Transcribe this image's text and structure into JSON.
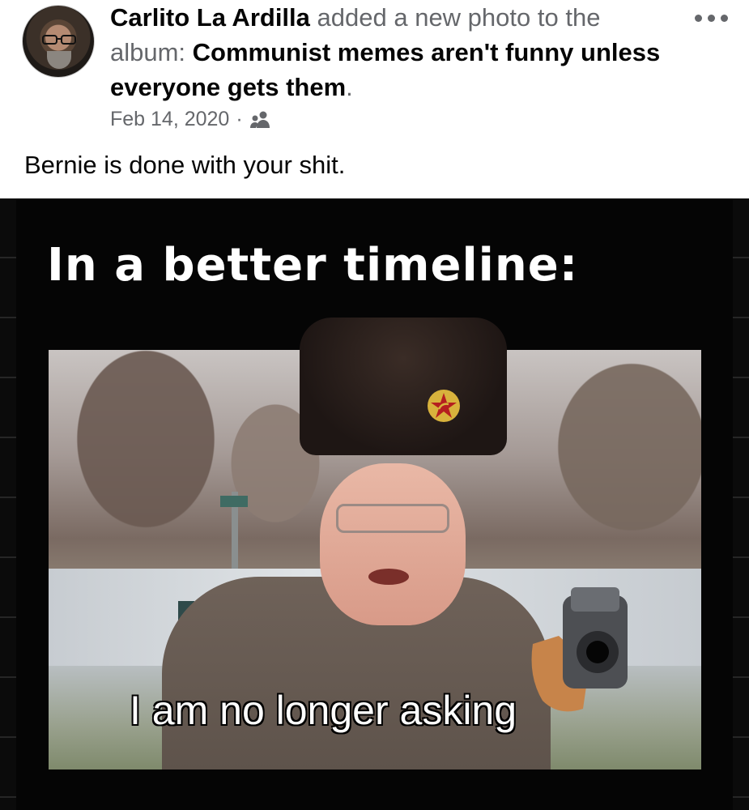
{
  "post": {
    "author": "Carlito La Ardilla",
    "action": "added a new photo to the album:",
    "album_name": "Communist memes aren't funny unless everyone gets them",
    "period": ".",
    "date": "Feb 14, 2020",
    "separator": "·",
    "audience_icon": "friends-icon",
    "caption": "Bernie is done with your shit."
  },
  "meme": {
    "top_text": "In a better timeline:",
    "bottom_text": "I am no longer asking"
  },
  "colors": {
    "secondary_text": "#65676b",
    "primary_text": "#050505",
    "meme_background": "#000000"
  }
}
